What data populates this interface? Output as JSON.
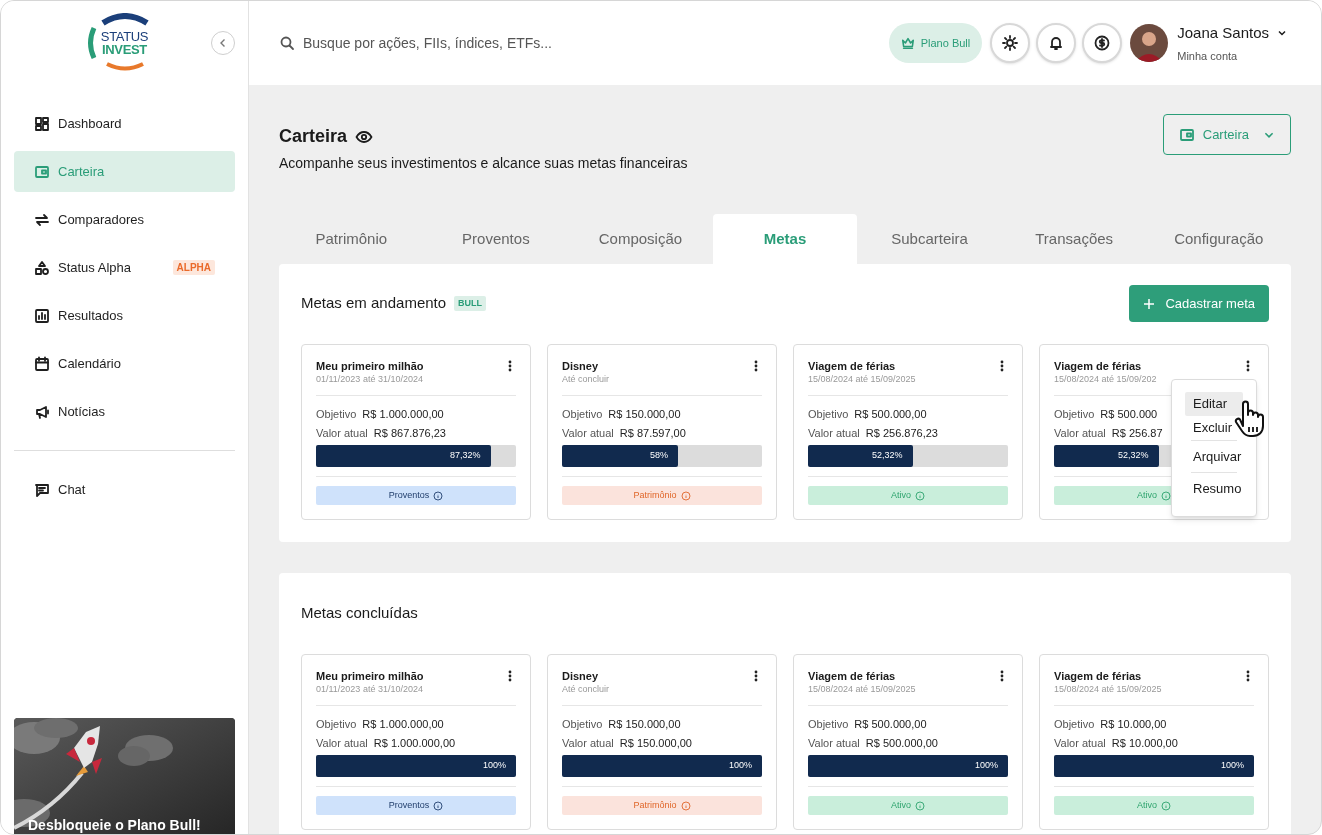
{
  "logo": {
    "line_1": "STATUS",
    "line_2": "INVEST"
  },
  "sidebar": {
    "items": [
      {
        "label": "Dashboard",
        "selected": false
      },
      {
        "label": "Carteira",
        "selected": true
      },
      {
        "label": "Comparadores",
        "selected": false
      },
      {
        "label": "Status Alpha",
        "selected": false,
        "badge": "ALPHA"
      },
      {
        "label": "Resultados",
        "selected": false
      },
      {
        "label": "Calendário",
        "selected": false
      },
      {
        "label": "Notícias",
        "selected": false
      }
    ],
    "footer_items": [
      {
        "label": "Chat",
        "selected": false
      }
    ],
    "promo": {
      "kind": "picture",
      "caption": "Desbloqueie o Plano Bull!"
    }
  },
  "header": {
    "search": {
      "placeholder": "Busque por ações, FIIs, índices, ETFs..."
    },
    "plan_button": "Plano Bull",
    "user": {
      "name": "Joana Santos",
      "subtitle": "Minha conta"
    }
  },
  "page": {
    "title": "Carteira",
    "subtitle": "Acompanhe seus investimentos e alcance suas metas financeiras",
    "dropdown": "Carteira"
  },
  "tabs": [
    {
      "label": "Patrimônio",
      "selected": false
    },
    {
      "label": "Proventos",
      "selected": false
    },
    {
      "label": "Composição",
      "selected": false
    },
    {
      "label": "Metas",
      "selected": true
    },
    {
      "label": "Subcarteira",
      "selected": false
    },
    {
      "label": "Transações",
      "selected": false
    },
    {
      "label": "Configuração",
      "selected": false
    }
  ],
  "sections": [
    {
      "title": "Metas em andamento",
      "badge": "BULL",
      "button": "Cadastrar meta",
      "cards": [
        {
          "name": "Meu primeiro milhão",
          "period": "01/11/2023 até 31/10/2024",
          "objective_label": "Objetivo",
          "objective": "R$ 1.000.000,00",
          "current_label": "Valor atual",
          "current": "R$ 867.876,23",
          "level": 0.8732,
          "reading": "87,32%",
          "tag": {
            "label": "Proventos",
            "kind": "proventos"
          }
        },
        {
          "name": "Disney",
          "period": "Até concluir",
          "objective_label": "Objetivo",
          "objective": "R$ 150.000,00",
          "current_label": "Valor atual",
          "current": "R$ 87.597,00",
          "level": 0.58,
          "reading": "58%",
          "tag": {
            "label": "Patrimônio",
            "kind": "patrimonio"
          }
        },
        {
          "name": "Viagem de férias",
          "period": "15/08/2024 até 15/09/2025",
          "objective_label": "Objetivo",
          "objective": "R$ 500.000,00",
          "current_label": "Valor atual",
          "current": "R$ 256.876,23",
          "level": 0.5232,
          "reading": "52,32%",
          "tag": {
            "label": "Ativo",
            "kind": "ativo"
          }
        },
        {
          "name": "Viagem de férias",
          "period": "15/08/2024 até 15/09/202",
          "objective_label": "Objetivo",
          "objective": "R$ 500.000",
          "current_label": "Valor atual",
          "current": "R$ 256.87",
          "level": 0.5232,
          "reading": "52,32%",
          "tag": {
            "label": "Ativo",
            "kind": "ativo"
          },
          "menu": {
            "items": [
              {
                "label": "Editar",
                "selected": true
              },
              {
                "label": "Excluir",
                "selected": false
              },
              {
                "label": "Arquivar",
                "selected": false
              },
              {
                "label": "Resumo",
                "selected": false
              }
            ]
          }
        }
      ]
    },
    {
      "title": "Metas concluídas",
      "cards": [
        {
          "name": "Meu primeiro milhão",
          "period": "01/11/2023 até 31/10/2024",
          "objective_label": "Objetivo",
          "objective": "R$ 1.000.000,00",
          "current_label": "Valor atual",
          "current": "R$ 1.000.000,00",
          "level": 1,
          "reading": "100%",
          "tag": {
            "label": "Proventos",
            "kind": "proventos"
          }
        },
        {
          "name": "Disney",
          "period": "Até concluir",
          "objective_label": "Objetivo",
          "objective": "R$ 150.000,00",
          "current_label": "Valor atual",
          "current": "R$ 150.000,00",
          "level": 1,
          "reading": "100%",
          "tag": {
            "label": "Patrimônio",
            "kind": "patrimonio"
          }
        },
        {
          "name": "Viagem de férias",
          "period": "15/08/2024 até 15/09/2025",
          "objective_label": "Objetivo",
          "objective": "R$ 500.000,00",
          "current_label": "Valor atual",
          "current": "R$ 500.000,00",
          "level": 1,
          "reading": "100%",
          "tag": {
            "label": "Ativo",
            "kind": "ativo"
          }
        },
        {
          "name": "Viagem de férias",
          "period": "15/08/2024 até 15/09/2025",
          "objective_label": "Objetivo",
          "objective": "R$ 10.000,00",
          "current_label": "Valor atual",
          "current": "R$ 10.000,00",
          "level": 1,
          "reading": "100%",
          "tag": {
            "label": "Ativo",
            "kind": "ativo"
          }
        }
      ]
    }
  ]
}
